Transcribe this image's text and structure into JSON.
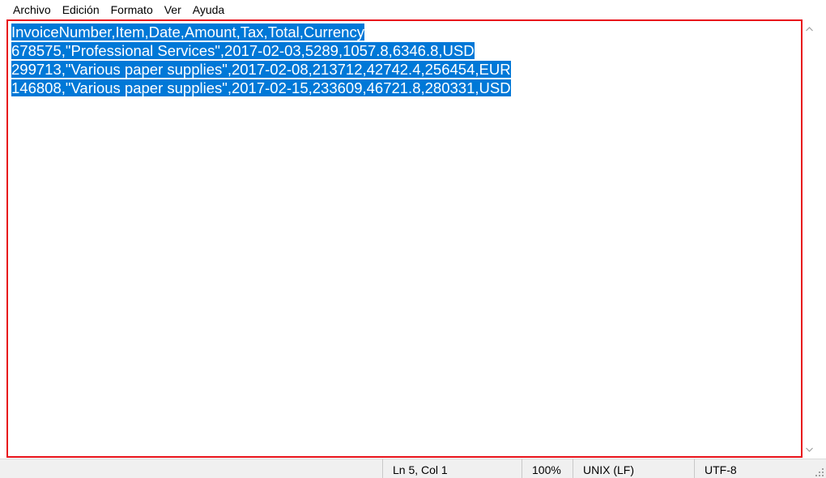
{
  "menubar": {
    "items": [
      "Archivo",
      "Edición",
      "Formato",
      "Ver",
      "Ayuda"
    ]
  },
  "editor": {
    "lines": [
      "InvoiceNumber,Item,Date,Amount,Tax,Total,Currency",
      "678575,\"Professional Services\",2017-02-03,5289,1057.8,6346.8,USD",
      "299713,\"Various paper supplies\",2017-02-08,213712,42742.4,256454,EUR",
      "146808,\"Various paper supplies\",2017-02-15,233609,46721.8,280331,USD"
    ],
    "selection_color": "#0078d7",
    "focus_border_color": "#e8131b"
  },
  "statusbar": {
    "position": "Ln 5, Col 1",
    "zoom": "100%",
    "line_ending": "UNIX (LF)",
    "encoding": "UTF-8"
  },
  "scrollbar": {
    "up_icon": "chevron-up-icon",
    "down_icon": "chevron-down-icon"
  }
}
